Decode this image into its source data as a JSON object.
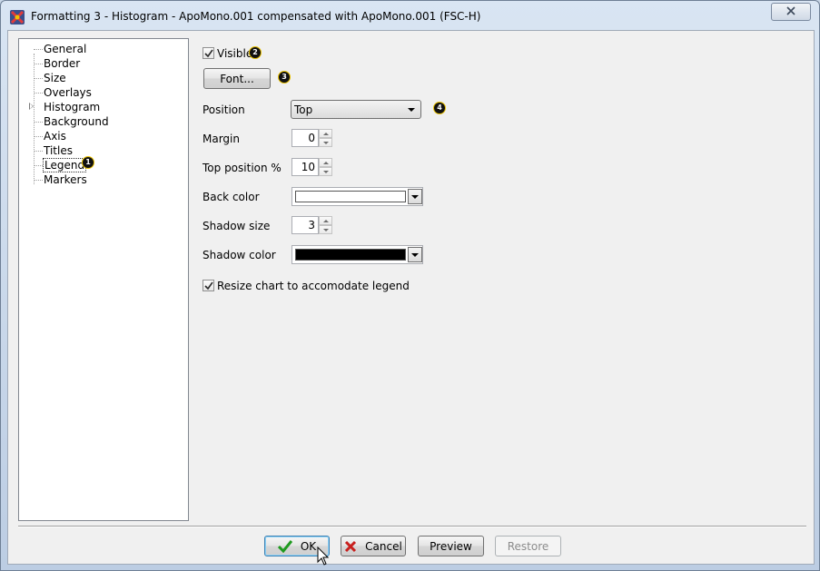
{
  "window": {
    "title": "Formatting 3 - Histogram - ApoMono.001 compensated with ApoMono.001 (FSC-H)",
    "close_icon": "close-icon"
  },
  "tree": {
    "items": [
      {
        "label": "General"
      },
      {
        "label": "Border"
      },
      {
        "label": "Size"
      },
      {
        "label": "Overlays"
      },
      {
        "label": "Histogram",
        "expandable": true
      },
      {
        "label": "Background"
      },
      {
        "label": "Axis"
      },
      {
        "label": "Titles"
      },
      {
        "label": "Legend",
        "selected": true
      },
      {
        "label": "Markers"
      }
    ]
  },
  "badges": {
    "b1": "1",
    "b2": "2",
    "b3": "3",
    "b4": "4"
  },
  "legend": {
    "visible_label": "Visible",
    "visible_checked": true,
    "font_button": "Font...",
    "position_label": "Position",
    "position_value": "Top",
    "margin_label": "Margin",
    "margin_value": "0",
    "top_position_label": "Top position %",
    "top_position_value": "10",
    "back_color_label": "Back color",
    "back_color_value": "#ffffff",
    "shadow_size_label": "Shadow size",
    "shadow_size_value": "3",
    "shadow_color_label": "Shadow color",
    "shadow_color_value": "#000000",
    "resize_label": "Resize chart to accomodate legend",
    "resize_checked": true
  },
  "footer": {
    "ok": "OK",
    "cancel": "Cancel",
    "preview": "Preview",
    "restore": "Restore"
  },
  "colors": {
    "ok_icon": "#1f9a1f",
    "cancel_icon": "#c8201e",
    "badge_ring": "#e8c000"
  }
}
